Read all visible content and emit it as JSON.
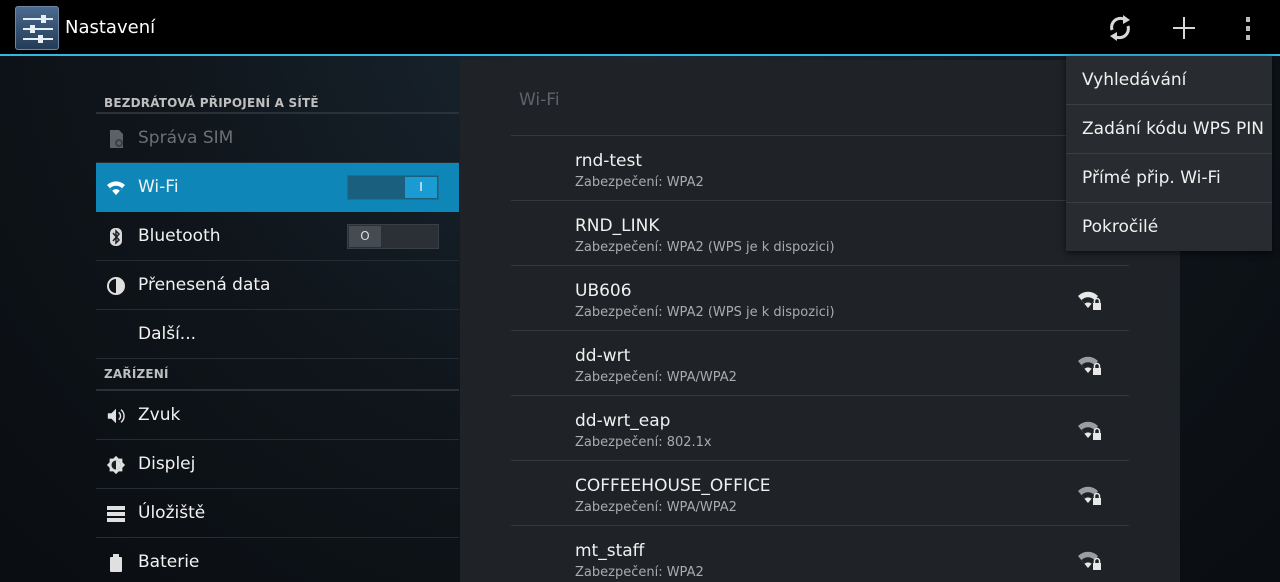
{
  "actionbar": {
    "title": "Nastavení",
    "app_icon": "settings-sliders-icon",
    "buttons": [
      "refresh-icon",
      "add-icon",
      "overflow-menu-icon"
    ],
    "accent_color": "#33b5e5"
  },
  "left_list": {
    "sections": [
      {
        "header": "BEZDRÁTOVÁ PŘIPOJENÍ A SÍTĚ",
        "items": [
          {
            "label": "Správa SIM",
            "icon": "sim-icon",
            "disabled": true
          },
          {
            "label": "Wi-Fi",
            "icon": "wifi-icon",
            "active": true,
            "toggle": "I"
          },
          {
            "label": "Bluetooth",
            "icon": "bluetooth-icon",
            "toggle": "O"
          },
          {
            "label": "Přenesená data",
            "icon": "data-usage-icon"
          },
          {
            "label": "Další...",
            "icon": ""
          }
        ]
      },
      {
        "header": "ZAŘÍZENÍ",
        "items": [
          {
            "label": "Zvuk",
            "icon": "sound-icon"
          },
          {
            "label": "Displej",
            "icon": "display-icon"
          },
          {
            "label": "Úložiště",
            "icon": "storage-icon"
          },
          {
            "label": "Baterie",
            "icon": "battery-icon"
          }
        ]
      }
    ]
  },
  "wifi_panel": {
    "title": "Wi-Fi",
    "networks": [
      {
        "ssid": "rnd-test",
        "security": "Zabezpečení: WPA2"
      },
      {
        "ssid": "RND_LINK",
        "security": "Zabezpečení: WPA2 (WPS je k dispozici)"
      },
      {
        "ssid": "UB606",
        "security": "Zabezpečení: WPA2 (WPS je k dispozici)"
      },
      {
        "ssid": "dd-wrt",
        "security": "Zabezpečení: WPA/WPA2"
      },
      {
        "ssid": "dd-wrt_eap",
        "security": "Zabezpečení: 802.1x"
      },
      {
        "ssid": "COFFEEHOUSE_OFFICE",
        "security": "Zabezpečení: WPA/WPA2"
      },
      {
        "ssid": "mt_staff",
        "security": "Zabezpečení: WPA2"
      }
    ]
  },
  "overflow_menu": {
    "items": [
      "Vyhledávání",
      "Zadání kódu WPS PIN",
      "Přímé přip. Wi-Fi",
      "Pokročilé"
    ]
  }
}
